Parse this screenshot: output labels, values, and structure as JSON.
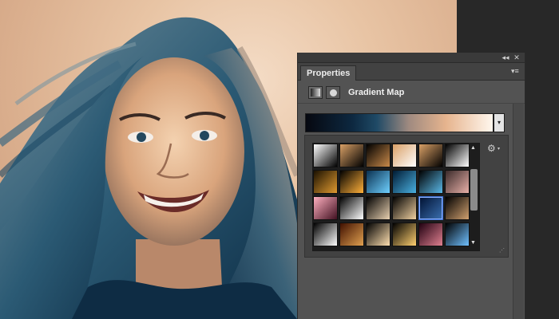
{
  "panel": {
    "tab_label": "Properties",
    "title": "Gradient Map",
    "collapse_glyph": "◂◂",
    "close_glyph": "✕",
    "menu_glyph": "▾≡",
    "dropdown_glyph": "▾",
    "gear_glyph": "⚙",
    "gear_caret_glyph": "▾",
    "scroll_up_glyph": "▲",
    "scroll_down_glyph": "▼",
    "resize_glyph": "⋰"
  },
  "colors": {
    "panel_bg": "#535353",
    "dark_bg": "#282828",
    "selection": "#3a6fd0"
  },
  "gradient_presets": [
    [
      "#ffffff|#000000",
      "#d9a066|#000000",
      "#000000|#c98a4a",
      "#d9a066|#ffffff",
      "#d9a066|#000000",
      "#000000|#ffffff"
    ],
    [
      "#1a1000|#e09a30",
      "#000000|#ffb03a",
      "#0a3050|#6fd0ff",
      "#001a33|#4ab0e0",
      "#000000|#5ab8e8",
      "#3a2a2a|#e8b0a8"
    ],
    [
      "#ffb0c0|#401020",
      "#000000|#ffffff",
      "#000000|#e8d0b0",
      "#000000|#f0d0a0",
      "#001030|#3a70b0",
      "#000000|#d0a070"
    ],
    [
      "#000000|#ffffff",
      "#401000|#e0a050",
      "#000000|#ffe0b0",
      "#000000|#ffd070",
      "#200010|#e08090",
      "#000000|#70c0ff"
    ]
  ],
  "selected_preset": [
    2,
    4
  ]
}
